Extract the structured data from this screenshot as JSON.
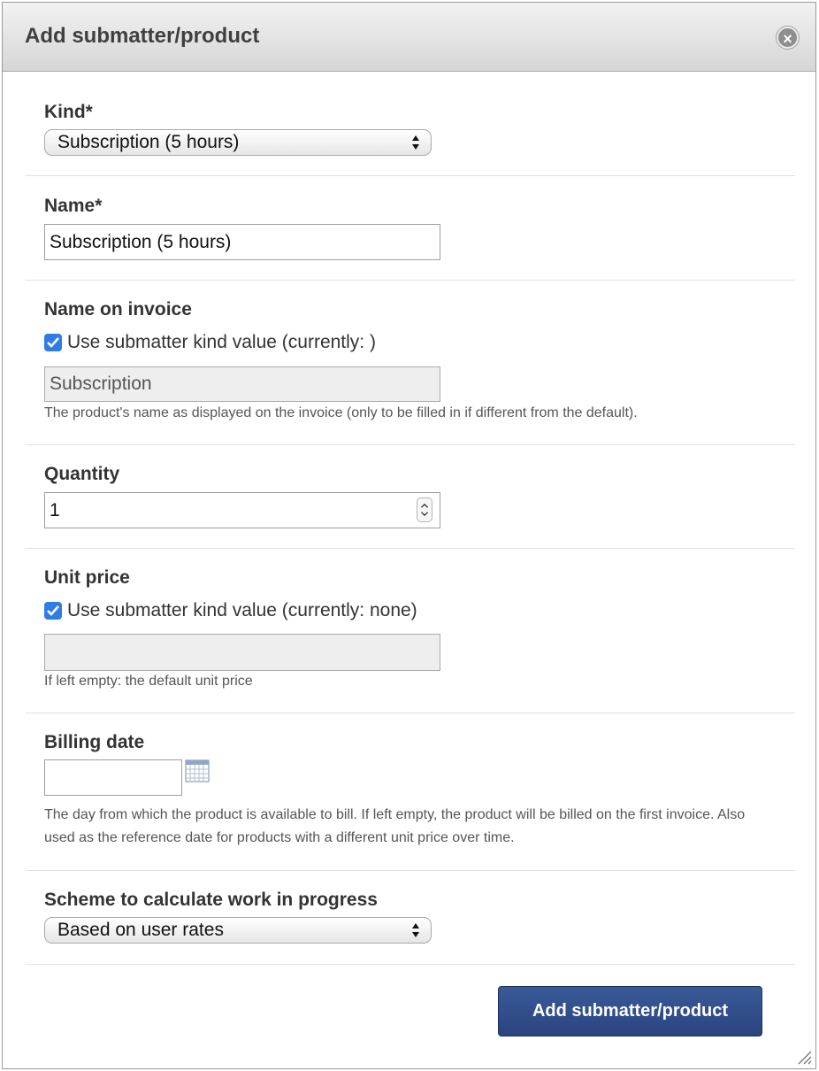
{
  "dialog": {
    "title": "Add submatter/product",
    "close_icon": "close-icon"
  },
  "kind": {
    "label": "Kind*",
    "selected": "Subscription (5 hours)"
  },
  "name": {
    "label": "Name*",
    "value": "Subscription (5 hours)"
  },
  "name_on_invoice": {
    "label": "Name on invoice",
    "checkbox_label": "Use submatter kind value (currently: )",
    "checked": true,
    "value": "Subscription",
    "help": "The product's name as displayed on the invoice (only to be filled in if different from the default)."
  },
  "quantity": {
    "label": "Quantity",
    "value": "1"
  },
  "unit_price": {
    "label": "Unit price",
    "checkbox_label": "Use submatter kind value (currently: none)",
    "checked": true,
    "value": "",
    "help": "If left empty: the default unit price"
  },
  "billing_date": {
    "label": "Billing date",
    "value": "",
    "calendar_icon": "calendar-icon",
    "help": "The day from which the product is available to bill. If left empty, the product will be billed on the first invoice. Also used as the reference date for products with a different unit price over time."
  },
  "wip_scheme": {
    "label": "Scheme to calculate work in progress",
    "selected": "Based on user rates"
  },
  "actions": {
    "submit_label": "Add submatter/product"
  },
  "colors": {
    "primary_button": "#2f4a89",
    "checkbox": "#2f7be8"
  }
}
